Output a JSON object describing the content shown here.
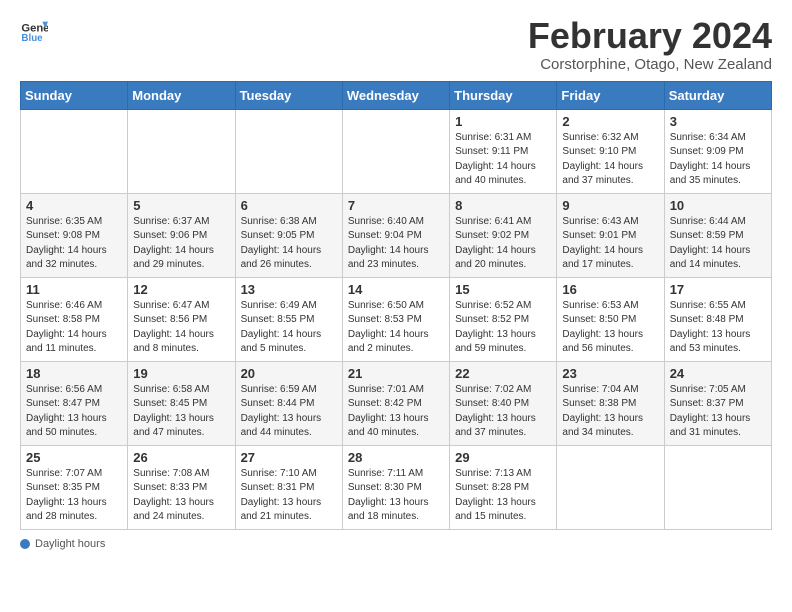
{
  "header": {
    "logo_line1": "General",
    "logo_line2": "Blue",
    "month_year": "February 2024",
    "location": "Corstorphine, Otago, New Zealand"
  },
  "weekdays": [
    "Sunday",
    "Monday",
    "Tuesday",
    "Wednesday",
    "Thursday",
    "Friday",
    "Saturday"
  ],
  "weeks": [
    [
      {
        "day": "",
        "info": ""
      },
      {
        "day": "",
        "info": ""
      },
      {
        "day": "",
        "info": ""
      },
      {
        "day": "",
        "info": ""
      },
      {
        "day": "1",
        "info": "Sunrise: 6:31 AM\nSunset: 9:11 PM\nDaylight: 14 hours\nand 40 minutes."
      },
      {
        "day": "2",
        "info": "Sunrise: 6:32 AM\nSunset: 9:10 PM\nDaylight: 14 hours\nand 37 minutes."
      },
      {
        "day": "3",
        "info": "Sunrise: 6:34 AM\nSunset: 9:09 PM\nDaylight: 14 hours\nand 35 minutes."
      }
    ],
    [
      {
        "day": "4",
        "info": "Sunrise: 6:35 AM\nSunset: 9:08 PM\nDaylight: 14 hours\nand 32 minutes."
      },
      {
        "day": "5",
        "info": "Sunrise: 6:37 AM\nSunset: 9:06 PM\nDaylight: 14 hours\nand 29 minutes."
      },
      {
        "day": "6",
        "info": "Sunrise: 6:38 AM\nSunset: 9:05 PM\nDaylight: 14 hours\nand 26 minutes."
      },
      {
        "day": "7",
        "info": "Sunrise: 6:40 AM\nSunset: 9:04 PM\nDaylight: 14 hours\nand 23 minutes."
      },
      {
        "day": "8",
        "info": "Sunrise: 6:41 AM\nSunset: 9:02 PM\nDaylight: 14 hours\nand 20 minutes."
      },
      {
        "day": "9",
        "info": "Sunrise: 6:43 AM\nSunset: 9:01 PM\nDaylight: 14 hours\nand 17 minutes."
      },
      {
        "day": "10",
        "info": "Sunrise: 6:44 AM\nSunset: 8:59 PM\nDaylight: 14 hours\nand 14 minutes."
      }
    ],
    [
      {
        "day": "11",
        "info": "Sunrise: 6:46 AM\nSunset: 8:58 PM\nDaylight: 14 hours\nand 11 minutes."
      },
      {
        "day": "12",
        "info": "Sunrise: 6:47 AM\nSunset: 8:56 PM\nDaylight: 14 hours\nand 8 minutes."
      },
      {
        "day": "13",
        "info": "Sunrise: 6:49 AM\nSunset: 8:55 PM\nDaylight: 14 hours\nand 5 minutes."
      },
      {
        "day": "14",
        "info": "Sunrise: 6:50 AM\nSunset: 8:53 PM\nDaylight: 14 hours\nand 2 minutes."
      },
      {
        "day": "15",
        "info": "Sunrise: 6:52 AM\nSunset: 8:52 PM\nDaylight: 13 hours\nand 59 minutes."
      },
      {
        "day": "16",
        "info": "Sunrise: 6:53 AM\nSunset: 8:50 PM\nDaylight: 13 hours\nand 56 minutes."
      },
      {
        "day": "17",
        "info": "Sunrise: 6:55 AM\nSunset: 8:48 PM\nDaylight: 13 hours\nand 53 minutes."
      }
    ],
    [
      {
        "day": "18",
        "info": "Sunrise: 6:56 AM\nSunset: 8:47 PM\nDaylight: 13 hours\nand 50 minutes."
      },
      {
        "day": "19",
        "info": "Sunrise: 6:58 AM\nSunset: 8:45 PM\nDaylight: 13 hours\nand 47 minutes."
      },
      {
        "day": "20",
        "info": "Sunrise: 6:59 AM\nSunset: 8:44 PM\nDaylight: 13 hours\nand 44 minutes."
      },
      {
        "day": "21",
        "info": "Sunrise: 7:01 AM\nSunset: 8:42 PM\nDaylight: 13 hours\nand 40 minutes."
      },
      {
        "day": "22",
        "info": "Sunrise: 7:02 AM\nSunset: 8:40 PM\nDaylight: 13 hours\nand 37 minutes."
      },
      {
        "day": "23",
        "info": "Sunrise: 7:04 AM\nSunset: 8:38 PM\nDaylight: 13 hours\nand 34 minutes."
      },
      {
        "day": "24",
        "info": "Sunrise: 7:05 AM\nSunset: 8:37 PM\nDaylight: 13 hours\nand 31 minutes."
      }
    ],
    [
      {
        "day": "25",
        "info": "Sunrise: 7:07 AM\nSunset: 8:35 PM\nDaylight: 13 hours\nand 28 minutes."
      },
      {
        "day": "26",
        "info": "Sunrise: 7:08 AM\nSunset: 8:33 PM\nDaylight: 13 hours\nand 24 minutes."
      },
      {
        "day": "27",
        "info": "Sunrise: 7:10 AM\nSunset: 8:31 PM\nDaylight: 13 hours\nand 21 minutes."
      },
      {
        "day": "28",
        "info": "Sunrise: 7:11 AM\nSunset: 8:30 PM\nDaylight: 13 hours\nand 18 minutes."
      },
      {
        "day": "29",
        "info": "Sunrise: 7:13 AM\nSunset: 8:28 PM\nDaylight: 13 hours\nand 15 minutes."
      },
      {
        "day": "",
        "info": ""
      },
      {
        "day": "",
        "info": ""
      }
    ]
  ],
  "footer": {
    "daylight_label": "Daylight hours"
  }
}
